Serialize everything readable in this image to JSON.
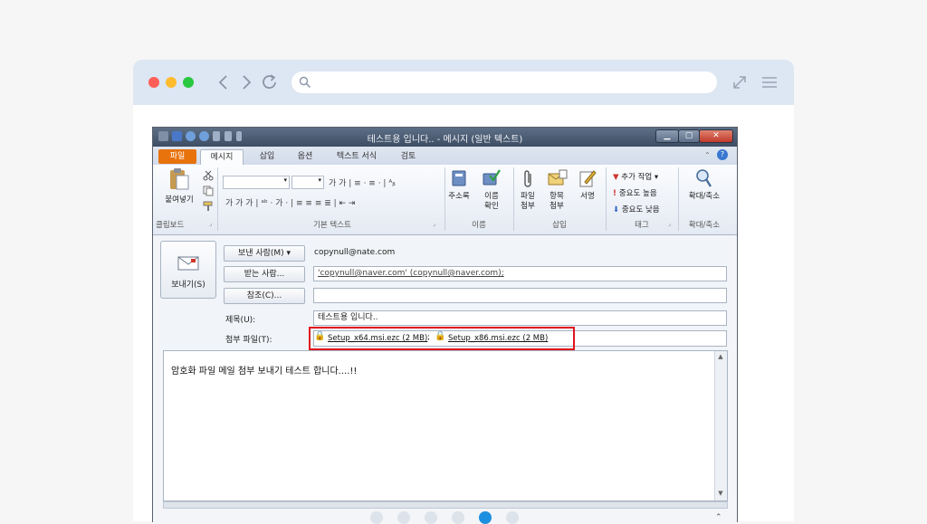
{
  "colors": {
    "page_bg": "#f6f6f6",
    "chrome_bg": "#dde6f3",
    "dot_red": "#ff5f57",
    "dot_yellow": "#febc2e",
    "dot_green": "#28c840",
    "highlight": "#e0141e",
    "pager_active": "#1d8fe0",
    "pager_inactive": "#dde3ea"
  },
  "browser": {
    "icons": [
      "back-icon",
      "forward-icon",
      "reload-icon",
      "search-icon",
      "expand-icon",
      "menu-icon"
    ],
    "url": ""
  },
  "outlook": {
    "title": "테스트용 입니다.. - 메시지 (일반 텍스트)",
    "tabs": [
      "파일",
      "메시지",
      "삽입",
      "옵션",
      "텍스트 서식",
      "검토"
    ],
    "active_tab": "메시지",
    "ribbon": {
      "paste": "붙여넣기",
      "clipboard": "클립보드",
      "basic_text": "기본 텍스트",
      "address_book": "주소록",
      "check_names_1": "이름",
      "check_names_2": "확인",
      "names": "이름",
      "attach_file_1": "파일",
      "attach_file_2": "첨부",
      "attach_item_1": "항목",
      "attach_item_2": "첨부",
      "signature": "서명",
      "insert": "삽입",
      "follow_up": "추가 작업",
      "high_importance": "중요도 높음",
      "low_importance": "중요도 낮음",
      "tags": "태그",
      "zoom": "확대/축소",
      "zoom_group": "확대/축소",
      "format_row1": "가 가 | ≡ · ≡ · | ᴬᵦ",
      "format_row2": "가 가 가 | ᵃᵇ · 가 · | ≡ ≡ ≡ ≣ | ⇤ ⇥"
    },
    "header": {
      "send": "보내기(S)",
      "from_button": "보낸 사람(M) ▾",
      "from_value": "copynull@nate.com",
      "to_button": "받는 사람...",
      "to_value": "'copynull@naver.com' (copynull@naver.com);",
      "cc_button": "참조(C)...",
      "cc_value": "",
      "subject_label": "제목(U):",
      "subject_value": "테스트용 입니다..",
      "attach_label": "첨부 파일(T):",
      "attachments": [
        "Setup_x64.msi.ezc (2 MB)",
        "Setup_x86.msi.ezc (2 MB)"
      ],
      "attach_separator": ";"
    },
    "body": "암호화 파일 메일 첨부 보내기 테스트 합니다....!!"
  },
  "pager": {
    "count": 6,
    "active_index": 4
  }
}
